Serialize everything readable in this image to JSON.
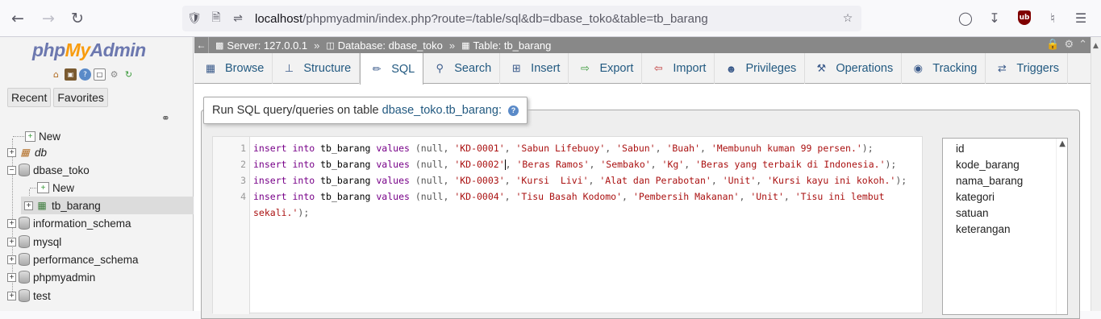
{
  "browser": {
    "url_prefix": "localhost",
    "url_rest": "/phpmyadmin/index.php?route=/table/sql&db=dbase_toko&table=tb_barang"
  },
  "sidebar": {
    "logo_php": "php",
    "logo_my": "My",
    "logo_admin": "Admin",
    "tabs": [
      "Recent",
      "Favorites"
    ],
    "tree": [
      {
        "label": "New"
      },
      {
        "label": "db"
      },
      {
        "label": "dbase_toko"
      },
      {
        "label": "New"
      },
      {
        "label": "tb_barang"
      },
      {
        "label": "information_schema"
      },
      {
        "label": "mysql"
      },
      {
        "label": "performance_schema"
      },
      {
        "label": "phpmyadmin"
      },
      {
        "label": "test"
      }
    ]
  },
  "breadcrumb": {
    "server": "Server: 127.0.0.1",
    "database": "Database: dbase_toko",
    "table": "Table: tb_barang",
    "sep": "»"
  },
  "menu": [
    "Browse",
    "Structure",
    "SQL",
    "Search",
    "Insert",
    "Export",
    "Import",
    "Privileges",
    "Operations",
    "Tracking",
    "Triggers"
  ],
  "sql_panel": {
    "legend_prefix": "Run SQL query/queries on table",
    "legend_table": "dbase_toko.tb_barang:",
    "help": "?"
  },
  "editor": {
    "line_numbers": [
      "1",
      "2",
      "3",
      "4"
    ],
    "lines": [
      {
        "kw1": "insert",
        "kw2": "into",
        "tbl": "tb_barang",
        "kw3": "values",
        "pre": " (null, ",
        "s1": "'KD-0001'",
        "rest": ", ",
        "s2": "'Sabun Lifebuoy'",
        "c2": ", ",
        "s3": "'Sabun'",
        "c3": ", ",
        "s4": "'Buah'",
        "c4": ", ",
        "s5": "'Membunuh kuman 99 persen.'",
        "end": ");"
      },
      {
        "kw1": "insert",
        "kw2": "into",
        "tbl": "tb_barang",
        "kw3": "values",
        "pre": " (null, ",
        "s1": "'KD-0002'",
        "rest": ", ",
        "s2": "'Beras Ramos'",
        "c2": ", ",
        "s3": "'Sembako'",
        "c3": ", ",
        "s4": "'Kg'",
        "c4": ", ",
        "s5": "'Beras yang terbaik di Indonesia.'",
        "end": ");"
      },
      {
        "kw1": "insert",
        "kw2": "into",
        "tbl": "tb_barang",
        "kw3": "values",
        "pre": " (null, ",
        "s1": "'KD-0003'",
        "rest": ", ",
        "s2": "'Kursi  Livi'",
        "c2": ", ",
        "s3": "'Alat dan Perabotan'",
        "c3": ", ",
        "s4": "'Unit'",
        "c4": ", ",
        "s5": "'Kursi kayu ini kokoh.'",
        "end": ");"
      },
      {
        "kw1": "insert",
        "kw2": "into",
        "tbl": "tb_barang",
        "kw3": "values",
        "pre": " (null, ",
        "s1": "'KD-0004'",
        "rest": ", ",
        "s2": "'Tisu Basah Kodomo'",
        "c2": ", ",
        "s3": "'Pembersih Makanan'",
        "c3": ", ",
        "s4": "'Unit'",
        "c4": ", ",
        "s5": "'Tisu ini lembut",
        "end": ""
      }
    ],
    "wrap_line": "sekali.'",
    "wrap_end": ");"
  },
  "columns": [
    "id",
    "kode_barang",
    "nama_barang",
    "kategori",
    "satuan",
    "keterangan"
  ]
}
